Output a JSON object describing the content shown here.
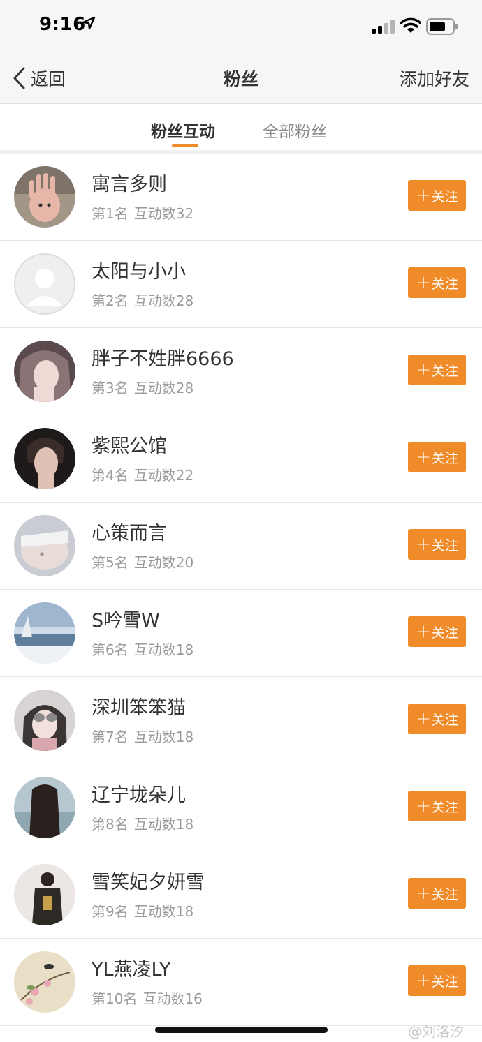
{
  "status_bar": {
    "time": "9:16",
    "icons": [
      "location-arrow-icon",
      "signal-icon",
      "wifi-icon",
      "battery-icon"
    ]
  },
  "nav": {
    "back_label": "返回",
    "title": "粉丝",
    "right_action": "添加好友"
  },
  "tabs": [
    {
      "label": "粉丝互动",
      "active": true
    },
    {
      "label": "全部粉丝",
      "active": false
    }
  ],
  "fans": [
    {
      "name": "寓言多则",
      "rank": "第1名",
      "interactions": "互动数32",
      "follow_label": "关注"
    },
    {
      "name": "太阳与小小",
      "rank": "第2名",
      "interactions": "互动数28",
      "follow_label": "关注"
    },
    {
      "name": "胖子不姓胖6666",
      "rank": "第3名",
      "interactions": "互动数28",
      "follow_label": "关注"
    },
    {
      "name": "紫熙公馆",
      "rank": "第4名",
      "interactions": "互动数22",
      "follow_label": "关注"
    },
    {
      "name": "心策而言",
      "rank": "第5名",
      "interactions": "互动数20",
      "follow_label": "关注"
    },
    {
      "name": "S吟雪W",
      "rank": "第6名",
      "interactions": "互动数18",
      "follow_label": "关注"
    },
    {
      "name": "深圳笨笨猫",
      "rank": "第7名",
      "interactions": "互动数18",
      "follow_label": "关注"
    },
    {
      "name": "辽宁垅朵儿",
      "rank": "第8名",
      "interactions": "互动数18",
      "follow_label": "关注"
    },
    {
      "name": "雪笑妃夕妍雪",
      "rank": "第9名",
      "interactions": "互动数18",
      "follow_label": "关注"
    },
    {
      "name": "YL燕凌LY",
      "rank": "第10名",
      "interactions": "互动数16",
      "follow_label": "关注"
    }
  ],
  "watermark": "@刘洛汐",
  "colors": {
    "accent": "#f08b2a",
    "nav_bg": "#f6f6f6",
    "secondary_text": "#9a9a9a"
  }
}
